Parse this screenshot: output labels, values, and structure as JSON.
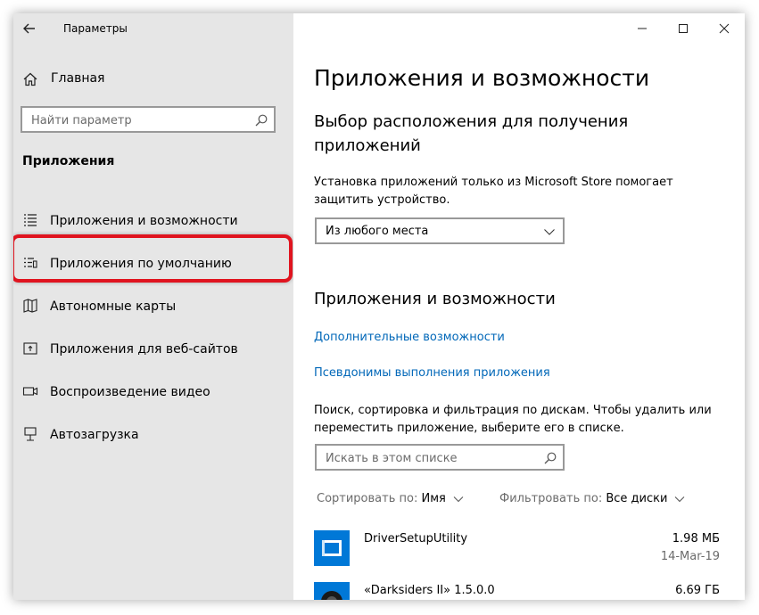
{
  "window": {
    "title": "Параметры"
  },
  "sidebar": {
    "home_label": "Главная",
    "search_placeholder": "Найти параметр",
    "section_title": "Приложения",
    "items": [
      {
        "label": "Приложения и возможности",
        "icon": "apps-list-icon"
      },
      {
        "label": "Приложения по умолчанию",
        "icon": "default-apps-icon"
      },
      {
        "label": "Автономные карты",
        "icon": "map-icon"
      },
      {
        "label": "Приложения для веб-сайтов",
        "icon": "web-app-icon"
      },
      {
        "label": "Воспроизведение видео",
        "icon": "video-icon"
      },
      {
        "label": "Автозагрузка",
        "icon": "startup-icon"
      }
    ]
  },
  "main": {
    "page_title": "Приложения и возможности",
    "location_heading": "Выбор расположения для получения приложений",
    "location_desc": "Установка приложений только из Microsoft Store помогает защитить устройство.",
    "location_select": "Из любого места",
    "apps_heading": "Приложения и возможности",
    "link_optional": "Дополнительные возможности",
    "link_aliases": "Псевдонимы выполнения приложения",
    "search_desc": "Поиск, сортировка и фильтрация по дискам. Чтобы удалить или переместить приложение, выберите его в списке.",
    "list_search_placeholder": "Искать в этом списке",
    "sort_label": "Сортировать по:",
    "sort_value": "Имя",
    "filter_label": "Фильтровать по:",
    "filter_value": "Все диски",
    "apps": [
      {
        "name": "DriverSetupUtility",
        "size": "1.98 МБ",
        "date": "14-Mar-19"
      },
      {
        "name": "«Darksiders II» 1.5.0.0",
        "size": "6.69 ГБ",
        "date": ""
      }
    ]
  },
  "colors": {
    "accent": "#0078d7",
    "link": "#0067b8",
    "highlight": "#e0141f",
    "sidebar_bg": "#e6e6e6"
  }
}
